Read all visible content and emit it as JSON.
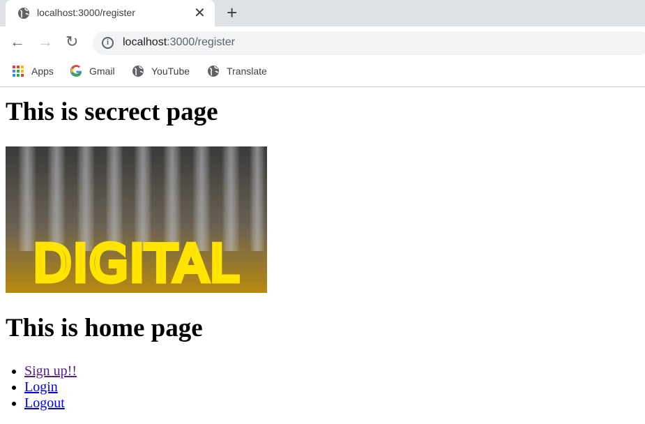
{
  "browser": {
    "tab_title": "localhost:3000/register",
    "url_host": "localhost",
    "url_path": ":3000/register",
    "bookmarks": [
      {
        "label": "Apps",
        "icon": "apps-grid-icon"
      },
      {
        "label": "Gmail",
        "icon": "google-icon"
      },
      {
        "label": "YouTube",
        "icon": "globe-icon"
      },
      {
        "label": "Translate",
        "icon": "globe-icon"
      }
    ]
  },
  "page": {
    "heading_secret": "This is secrect page",
    "image_text": "DIGITAL",
    "heading_home": "This is home page",
    "links": [
      {
        "label": "Sign up!!",
        "visited": true
      },
      {
        "label": "Login",
        "visited": false
      },
      {
        "label": "Logout",
        "visited": false
      }
    ]
  },
  "colors": {
    "link": "#0000ee",
    "visited": "#551a8b",
    "neon": "#ffe400"
  }
}
